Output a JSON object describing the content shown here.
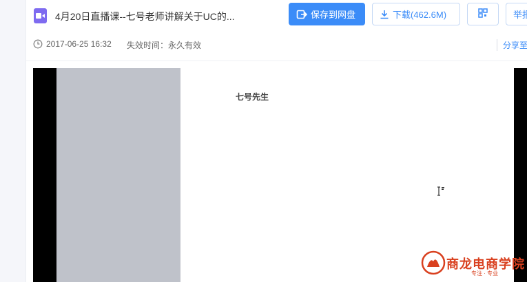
{
  "file": {
    "title": "4月20日直播课--七号老师讲解关于UC的...",
    "icon": "video-file-icon"
  },
  "toolbar": {
    "save_label": "保存到网盘",
    "download_label": "下载(462.6M)",
    "qr_icon": "qr-code-icon",
    "report_label": "举报"
  },
  "meta": {
    "date": "2017-06-25 16:32",
    "expire": "失效时间：永久有效",
    "share_label": "分享至"
  },
  "video": {
    "frame_text": "七号先生"
  },
  "watermark": {
    "title": "商龙电商学院",
    "subtitle": "专注 · 专业"
  },
  "colors": {
    "accent": "#3b8cf8",
    "file_icon": "#7e6bf0",
    "watermark": "#d9401f"
  }
}
